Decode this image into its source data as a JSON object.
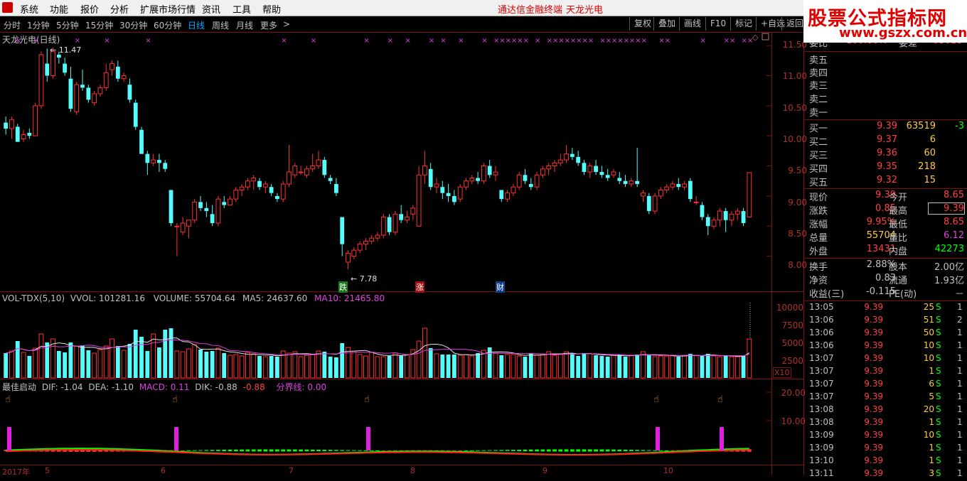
{
  "menu": {
    "items": [
      "系统",
      "功能",
      "报价",
      "分析",
      "扩展市场行情",
      "资讯",
      "工具",
      "帮助"
    ],
    "brand": "通达信金融终端",
    "stock": "天龙光电"
  },
  "watermark": {
    "line1": "股票公式指标网",
    "line2": "www.gszx.com.cn"
  },
  "toolbar": {
    "periods": [
      "分时",
      "1分钟",
      "5分钟",
      "15分钟",
      "30分钟",
      "60分钟",
      "日线",
      "周线",
      "月线",
      "更多"
    ],
    "active_period": "日线",
    "more_arrow": ">",
    "buttons": [
      "复权",
      "叠加",
      "画线",
      "F10",
      "标记",
      "+自选",
      "返回"
    ]
  },
  "chart_title": "天龙光电(日线)",
  "price_axis": [
    "11.50",
    "11.00",
    "10.50",
    "10.00",
    "9.50",
    "9.00",
    "8.50",
    "8.00"
  ],
  "annotations": {
    "high": "11.47",
    "low": "7.78",
    "marker_die": "跌",
    "marker_zhang": "涨",
    "marker_cai": "财"
  },
  "volume_indicator": {
    "name": "VOL-TDX(5,10)",
    "vvol": "VVOL: 101281.16",
    "volume": "VOLUME: 55704.64",
    "ma5": "MA5: 24637.60",
    "ma10": "MA10: 21465.80",
    "axis": [
      "10000",
      "7500",
      "5000",
      "2500"
    ],
    "scale": "X10"
  },
  "macd_indicator": {
    "name": "最佳启动",
    "dif": "DIF: -1.04",
    "dea": "DEA: -1.10",
    "macd": "MACD: 0.11",
    "dik": "DIK: -0.88",
    "extra": "-0.88",
    "split": "分界线: 0.00",
    "axis": [
      "20.00",
      "10.00"
    ]
  },
  "date_axis": [
    "2017年",
    "5",
    "6",
    "7",
    "8",
    "9",
    "10"
  ],
  "order_book": {
    "header_left": "委比",
    "header_left_value": "100.00%",
    "header_right": "委差",
    "header_right_value": "63618",
    "sells": [
      "卖五",
      "卖四",
      "卖三",
      "卖二",
      "卖一"
    ],
    "buys": [
      {
        "label": "买一",
        "price": "9.39",
        "vol": "63519",
        "chg": "-3"
      },
      {
        "label": "买二",
        "price": "9.37",
        "vol": "6",
        "chg": ""
      },
      {
        "label": "买三",
        "price": "9.36",
        "vol": "60",
        "chg": ""
      },
      {
        "label": "买四",
        "price": "9.35",
        "vol": "218",
        "chg": ""
      },
      {
        "label": "买五",
        "price": "9.32",
        "vol": "15",
        "chg": ""
      }
    ]
  },
  "stats": {
    "xianjia_l": "现价",
    "xianjia_v": "9.39",
    "jinkai_l": "今开",
    "jinkai_v": "8.65",
    "zhangdie_l": "涨跌",
    "zhangdie_v": "0.85",
    "zuigao_l": "最高",
    "zuigao_v": "9.39",
    "zhangfu_l": "涨幅",
    "zhangfu_v": "9.95%",
    "zuidi_l": "最低",
    "zuidi_v": "8.65",
    "zongliang_l": "总量",
    "zongliang_v": "55704",
    "liangbi_l": "量比",
    "liangbi_v": "6.12",
    "waipan_l": "外盘",
    "waipan_v": "13431",
    "neipan_l": "内盘",
    "neipan_v": "42273",
    "huanshou_l": "换手",
    "huanshou_v": "2.88%",
    "guben_l": "股本",
    "guben_v": "2.00亿",
    "jingzi_l": "净资",
    "jingzi_v": "0.83",
    "liutong_l": "流通",
    "liutong_v": "1.93亿",
    "shouyi_l": "收益(三)",
    "shouyi_v": "-0.115",
    "pe_l": "PE(动)",
    "pe_v": "－"
  },
  "ticks": [
    {
      "time": "13:05",
      "price": "9.39",
      "vol": "25",
      "bs": "S",
      "n": "1"
    },
    {
      "time": "13:06",
      "price": "9.39",
      "vol": "51",
      "bs": "S",
      "n": "2"
    },
    {
      "time": "13:06",
      "price": "9.39",
      "vol": "50",
      "bs": "S",
      "n": "1"
    },
    {
      "time": "13:06",
      "price": "9.39",
      "vol": "10",
      "bs": "S",
      "n": "1"
    },
    {
      "time": "13:07",
      "price": "9.39",
      "vol": "10",
      "bs": "S",
      "n": "1"
    },
    {
      "time": "13:07",
      "price": "9.39",
      "vol": "1",
      "bs": "S",
      "n": "1"
    },
    {
      "time": "13:07",
      "price": "9.39",
      "vol": "6",
      "bs": "S",
      "n": "1"
    },
    {
      "time": "13:07",
      "price": "9.39",
      "vol": "5",
      "bs": "S",
      "n": "1"
    },
    {
      "time": "13:08",
      "price": "9.39",
      "vol": "20",
      "bs": "S",
      "n": "1"
    },
    {
      "time": "13:08",
      "price": "9.39",
      "vol": "1",
      "bs": "S",
      "n": "1"
    },
    {
      "time": "13:09",
      "price": "9.39",
      "vol": "10",
      "bs": "S",
      "n": "1"
    },
    {
      "time": "13:09",
      "price": "9.39",
      "vol": "1",
      "bs": "S",
      "n": "1"
    },
    {
      "time": "13:10",
      "price": "9.39",
      "vol": "1",
      "bs": "S",
      "n": "1"
    },
    {
      "time": "13:11",
      "price": "9.39",
      "vol": "3",
      "bs": "S",
      "n": "1"
    }
  ],
  "chart_data": {
    "type": "candlestick",
    "ylim": [
      7.75,
      11.6
    ],
    "candles": [
      [
        10.22,
        10.32,
        10.02,
        10.12
      ],
      [
        10.12,
        10.32,
        9.95,
        10.27
      ],
      [
        10.15,
        10.2,
        9.9,
        9.9
      ],
      [
        9.95,
        10.1,
        9.9,
        10.02
      ],
      [
        10.05,
        10.12,
        9.95,
        10.0
      ],
      [
        10.0,
        10.55,
        10.0,
        10.5
      ],
      [
        10.5,
        11.4,
        10.45,
        11.35
      ],
      [
        11.2,
        11.45,
        10.9,
        11.0
      ],
      [
        11.0,
        11.47,
        10.95,
        11.4
      ],
      [
        11.35,
        11.4,
        11.2,
        11.3
      ],
      [
        11.2,
        11.3,
        11.0,
        11.05
      ],
      [
        10.95,
        11.15,
        10.4,
        10.45
      ],
      [
        10.4,
        10.9,
        10.35,
        10.85
      ],
      [
        10.85,
        11.1,
        10.75,
        10.8
      ],
      [
        10.8,
        10.85,
        10.55,
        10.6
      ],
      [
        10.55,
        10.75,
        10.5,
        10.7
      ],
      [
        10.7,
        10.85,
        10.65,
        10.8
      ],
      [
        10.8,
        11.2,
        10.75,
        11.05
      ],
      [
        11.1,
        11.25,
        11.0,
        11.2
      ],
      [
        11.15,
        11.25,
        10.9,
        10.95
      ],
      [
        10.95,
        11.05,
        10.9,
        11.0
      ],
      [
        10.85,
        10.95,
        10.55,
        10.6
      ],
      [
        10.55,
        10.6,
        10.1,
        10.15
      ],
      [
        10.1,
        10.15,
        9.7,
        9.7
      ],
      [
        9.7,
        9.75,
        9.35,
        9.55
      ],
      [
        9.55,
        9.7,
        9.5,
        9.6
      ],
      [
        9.6,
        9.7,
        9.4,
        9.55
      ],
      [
        9.55,
        9.6,
        9.4,
        9.45
      ],
      [
        9.1,
        9.1,
        8.5,
        8.55
      ],
      [
        8.5,
        8.55,
        8.0,
        8.5
      ],
      [
        8.4,
        8.65,
        8.35,
        8.55
      ],
      [
        8.5,
        8.6,
        8.3,
        8.6
      ],
      [
        8.6,
        8.95,
        8.55,
        8.9
      ],
      [
        8.9,
        9.0,
        8.75,
        8.8
      ],
      [
        8.8,
        8.9,
        8.65,
        8.75
      ],
      [
        8.7,
        8.85,
        8.5,
        8.55
      ],
      [
        8.55,
        9.0,
        8.5,
        8.95
      ],
      [
        8.9,
        9.0,
        8.8,
        8.85
      ],
      [
        8.85,
        9.0,
        8.85,
        8.95
      ],
      [
        8.95,
        9.15,
        8.9,
        9.1
      ],
      [
        9.1,
        9.2,
        9.0,
        9.15
      ],
      [
        9.15,
        9.3,
        9.1,
        9.25
      ],
      [
        9.25,
        9.35,
        9.1,
        9.3
      ],
      [
        9.25,
        9.3,
        9.1,
        9.15
      ],
      [
        9.15,
        9.25,
        9.05,
        9.2
      ],
      [
        9.15,
        9.2,
        9.0,
        9.05
      ],
      [
        9.0,
        9.05,
        8.9,
        8.95
      ],
      [
        8.95,
        9.25,
        8.9,
        9.2
      ],
      [
        9.2,
        9.85,
        9.15,
        9.4
      ],
      [
        9.35,
        9.55,
        9.3,
        9.5
      ],
      [
        9.4,
        9.5,
        9.35,
        9.4
      ],
      [
        9.35,
        9.5,
        9.3,
        9.45
      ],
      [
        9.45,
        9.7,
        9.4,
        9.5
      ],
      [
        9.5,
        9.75,
        9.45,
        9.6
      ],
      [
        9.6,
        9.65,
        9.3,
        9.35
      ],
      [
        9.3,
        9.35,
        9.2,
        9.25
      ],
      [
        9.2,
        9.3,
        9.0,
        9.05
      ],
      [
        8.65,
        8.65,
        8.0,
        8.2
      ],
      [
        7.9,
        8.1,
        7.78,
        8.05
      ],
      [
        8.0,
        8.15,
        7.95,
        8.1
      ],
      [
        8.1,
        8.25,
        8.05,
        8.2
      ],
      [
        8.2,
        8.3,
        8.1,
        8.25
      ],
      [
        8.25,
        8.35,
        8.2,
        8.3
      ],
      [
        8.3,
        8.4,
        8.25,
        8.35
      ],
      [
        8.35,
        8.7,
        8.3,
        8.65
      ],
      [
        8.65,
        8.7,
        8.35,
        8.4
      ],
      [
        8.4,
        8.75,
        8.35,
        8.7
      ],
      [
        8.7,
        8.85,
        8.55,
        8.6
      ],
      [
        8.6,
        8.75,
        8.55,
        8.65
      ],
      [
        8.7,
        8.85,
        8.6,
        8.8
      ],
      [
        8.5,
        9.5,
        8.5,
        9.35
      ],
      [
        9.35,
        9.75,
        9.2,
        9.5
      ],
      [
        9.45,
        9.55,
        9.1,
        9.15
      ],
      [
        9.15,
        9.3,
        9.05,
        9.2
      ],
      [
        9.15,
        9.25,
        8.95,
        9.05
      ],
      [
        9.05,
        9.2,
        8.9,
        9.0
      ],
      [
        9.0,
        9.1,
        8.85,
        8.9
      ],
      [
        8.95,
        9.2,
        8.9,
        9.15
      ],
      [
        9.15,
        9.3,
        9.1,
        9.25
      ],
      [
        9.25,
        9.35,
        9.2,
        9.3
      ],
      [
        9.3,
        9.4,
        9.2,
        9.25
      ],
      [
        9.25,
        9.55,
        9.2,
        9.5
      ],
      [
        9.5,
        9.6,
        9.3,
        9.35
      ],
      [
        9.35,
        9.5,
        9.25,
        9.4
      ],
      [
        9.1,
        9.1,
        8.9,
        8.95
      ],
      [
        8.95,
        9.1,
        8.9,
        9.05
      ],
      [
        9.05,
        9.2,
        9.0,
        9.15
      ],
      [
        9.15,
        9.4,
        9.1,
        9.35
      ],
      [
        9.35,
        9.45,
        9.2,
        9.25
      ],
      [
        9.2,
        9.3,
        9.1,
        9.15
      ],
      [
        9.15,
        9.4,
        9.1,
        9.35
      ],
      [
        9.35,
        9.5,
        9.3,
        9.45
      ],
      [
        9.45,
        9.55,
        9.35,
        9.5
      ],
      [
        9.5,
        9.6,
        9.4,
        9.55
      ],
      [
        9.55,
        9.7,
        9.5,
        9.6
      ],
      [
        9.6,
        9.85,
        9.55,
        9.7
      ],
      [
        9.7,
        9.8,
        9.6,
        9.65
      ],
      [
        9.65,
        9.75,
        9.5,
        9.55
      ],
      [
        9.55,
        9.6,
        9.35,
        9.4
      ],
      [
        9.4,
        9.55,
        9.3,
        9.5
      ],
      [
        9.5,
        9.6,
        9.35,
        9.4
      ],
      [
        9.4,
        9.5,
        9.3,
        9.35
      ],
      [
        9.35,
        9.45,
        9.25,
        9.3
      ],
      [
        9.35,
        9.45,
        9.3,
        9.4
      ],
      [
        9.3,
        9.4,
        9.2,
        9.25
      ],
      [
        9.25,
        9.35,
        9.15,
        9.2
      ],
      [
        9.2,
        9.3,
        9.15,
        9.25
      ],
      [
        9.25,
        9.8,
        9.15,
        9.2
      ],
      [
        9.0,
        9.1,
        8.9,
        9.05
      ],
      [
        9.0,
        9.05,
        8.7,
        8.75
      ],
      [
        8.75,
        9.05,
        8.7,
        9.0
      ],
      [
        9.0,
        9.15,
        8.95,
        9.1
      ],
      [
        9.1,
        9.2,
        9.05,
        9.15
      ],
      [
        9.15,
        9.25,
        9.1,
        9.2
      ],
      [
        9.2,
        9.3,
        9.1,
        9.15
      ],
      [
        9.15,
        9.25,
        9.1,
        9.2
      ],
      [
        9.25,
        9.3,
        8.9,
        8.95
      ],
      [
        8.9,
        9.0,
        8.85,
        8.9
      ],
      [
        8.85,
        8.9,
        8.6,
        8.65
      ],
      [
        8.65,
        8.7,
        8.35,
        8.5
      ],
      [
        8.5,
        8.65,
        8.45,
        8.6
      ],
      [
        8.6,
        8.8,
        8.5,
        8.75
      ],
      [
        8.75,
        8.8,
        8.4,
        8.6
      ],
      [
        8.6,
        8.75,
        8.5,
        8.7
      ],
      [
        8.7,
        8.8,
        8.6,
        8.75
      ],
      [
        8.75,
        8.8,
        8.5,
        8.55
      ],
      [
        8.65,
        9.39,
        8.65,
        9.39
      ]
    ],
    "volume": [
      3500,
      3800,
      5200,
      3600,
      3100,
      4200,
      6200,
      5000,
      5500,
      3800,
      3600,
      5000,
      4500,
      4600,
      3900,
      3500,
      4000,
      4500,
      5500,
      4500,
      3900,
      4800,
      6800,
      5800,
      3800,
      6200,
      4300,
      6800,
      7000,
      3800,
      3700,
      4100,
      4700,
      4000,
      3700,
      3800,
      4200,
      3500,
      3200,
      3300,
      3100,
      3600,
      3400,
      3100,
      3000,
      3100,
      3000,
      3800,
      3500,
      3700,
      3000,
      3200,
      3300,
      3800,
      3700,
      3000,
      2900,
      4900,
      4300,
      3800,
      3300,
      3100,
      3600,
      3000,
      3000,
      3100,
      3500,
      3200,
      3300,
      4000,
      5200,
      7000,
      4200,
      3400,
      3300,
      3300,
      3300,
      3200,
      3300,
      3100,
      3500,
      3900,
      4300,
      3500,
      3200,
      3300,
      3300,
      3100,
      3000,
      3500,
      3200,
      3400,
      3700,
      3200,
      3400,
      3700,
      3500,
      3100,
      3500,
      3400,
      3200,
      3100,
      3000,
      3200,
      3300,
      3000,
      3200,
      3300,
      3700,
      3200,
      3000,
      3100,
      3100,
      3200,
      3000,
      3100,
      3400,
      3200,
      3100,
      3400,
      3100,
      3000,
      3100,
      3000,
      3000,
      3100,
      5500
    ]
  }
}
